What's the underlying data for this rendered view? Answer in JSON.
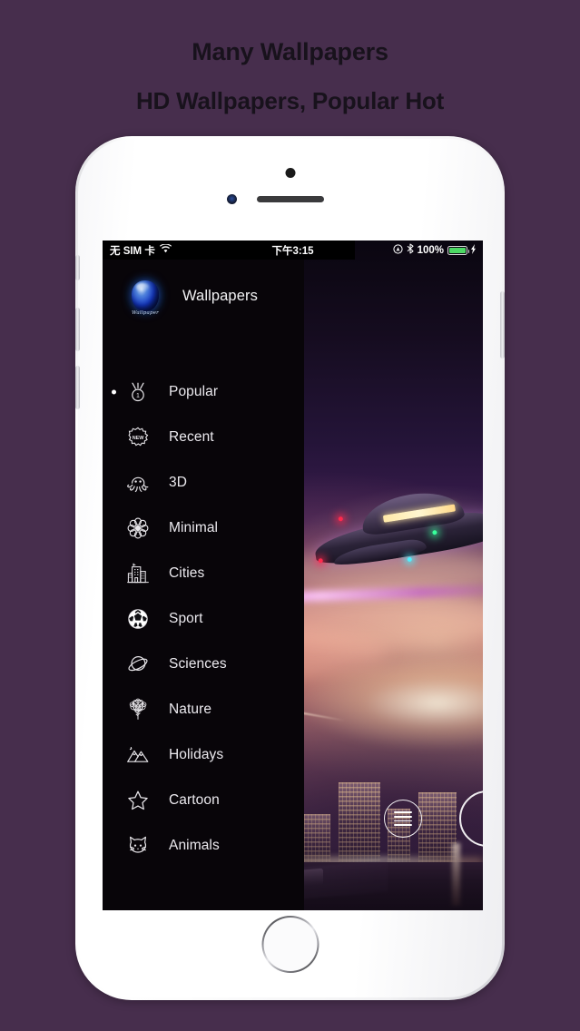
{
  "promo": {
    "headline": "Many Wallpapers",
    "subheadline": "HD Wallpapers, Popular Hot",
    "background_color": "#472E4D",
    "text_color": "#18121C"
  },
  "device": {
    "model": "iPhone",
    "body_color": "#FFFFFF"
  },
  "status_bar": {
    "carrier": "无 SIM 卡",
    "wifi_icon": "wifi-icon",
    "time": "下午3:15",
    "location_icon": "location-icon",
    "bluetooth_icon": "bluetooth-icon",
    "battery_percent": "100%",
    "battery_color": "#4CD964",
    "charging_icon": "bolt-icon"
  },
  "drawer": {
    "background_color": "#080509",
    "logo_icon": "app-logo-orb-icon",
    "logo_caption": "Wallpaper",
    "app_title": "Wallpapers",
    "active_index": 0,
    "items": [
      {
        "label": "Popular",
        "icon": "medal-icon",
        "active": true
      },
      {
        "label": "Recent",
        "icon": "new-badge-icon",
        "active": false
      },
      {
        "label": "3D",
        "icon": "octopus-icon",
        "active": false
      },
      {
        "label": "Minimal",
        "icon": "flower-icon",
        "active": false
      },
      {
        "label": "Cities",
        "icon": "building-icon",
        "active": false
      },
      {
        "label": "Sport",
        "icon": "soccer-ball-icon",
        "active": false
      },
      {
        "label": "Sciences",
        "icon": "planet-icon",
        "active": false
      },
      {
        "label": "Nature",
        "icon": "tree-icon",
        "active": false
      },
      {
        "label": "Holidays",
        "icon": "mountains-icon",
        "active": false
      },
      {
        "label": "Cartoon",
        "icon": "star-icon",
        "active": false
      },
      {
        "label": "Animals",
        "icon": "cat-face-icon",
        "active": false
      }
    ]
  },
  "wallpaper": {
    "description": "Futuristic sci-fi city at dusk with flying spaceship",
    "accent_colors": [
      "#C9705E",
      "#3A1C4E",
      "#D65CF0"
    ]
  },
  "floating_buttons": {
    "menu_icon": "hamburger-menu-icon",
    "secondary_icon": "minus-circle-icon"
  }
}
